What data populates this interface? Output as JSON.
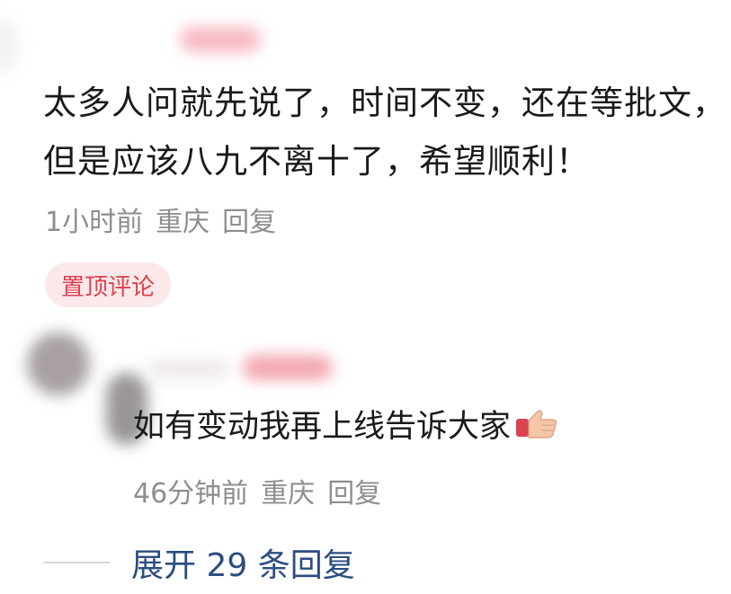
{
  "pinned_comment": {
    "text": "太多人问就先说了，时间不变，还在等批文，但是应该八九不离十了，希望顺利！",
    "time": "1小时前",
    "location": "重庆",
    "reply_label": "回复",
    "badge": "置顶评论"
  },
  "reply_comment": {
    "text": "如有变动我再上线告诉大家",
    "emoji": "thumbs-up-emoji",
    "time": "46分钟前",
    "location": "重庆",
    "reply_label": "回复"
  },
  "expand": {
    "label": "展开 29 条回复"
  },
  "colors": {
    "text": "#1a1a1a",
    "meta": "#8e8e8e",
    "badge_bg": "#fbe9ea",
    "badge_text": "#e0404f",
    "link": "#2b4d80"
  }
}
